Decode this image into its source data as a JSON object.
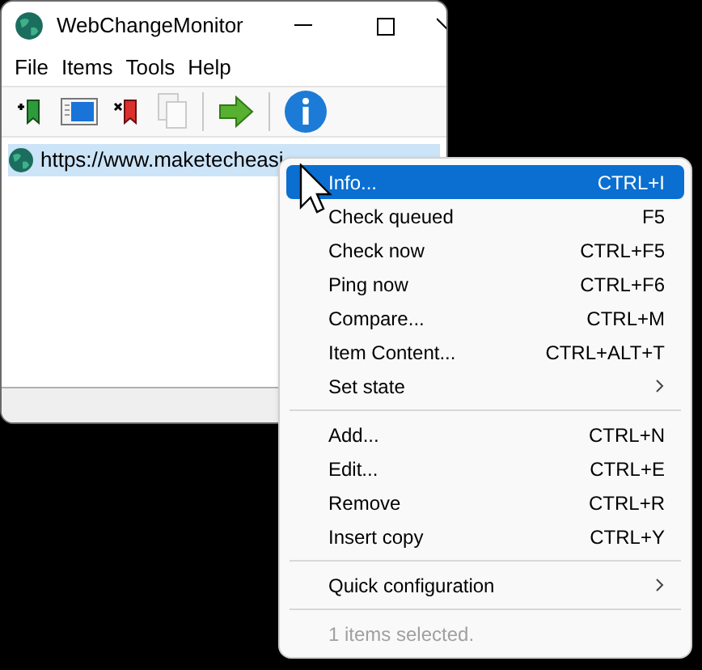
{
  "window": {
    "title": "WebChangeMonitor"
  },
  "menu_bar": [
    "File",
    "Items",
    "Tools",
    "Help"
  ],
  "toolbar": [
    {
      "kind": "add"
    },
    {
      "kind": "view"
    },
    {
      "kind": "remove"
    },
    {
      "kind": "copy",
      "disabled": true
    },
    {
      "kind": "separator"
    },
    {
      "kind": "go"
    },
    {
      "kind": "separator"
    },
    {
      "kind": "info"
    }
  ],
  "list": {
    "items": [
      {
        "text": "https://www.maketecheasi",
        "selected": true
      }
    ]
  },
  "context_menu": {
    "items": [
      {
        "kind": "item",
        "label": "Info...",
        "shortcut": "CTRL+I",
        "selected": true
      },
      {
        "kind": "item",
        "label": "Check queued",
        "shortcut": "F5",
        "selected": false
      },
      {
        "kind": "item",
        "label": "Check now",
        "shortcut": "CTRL+F5",
        "selected": false
      },
      {
        "kind": "item",
        "label": "Ping now",
        "shortcut": "CTRL+F6",
        "selected": false
      },
      {
        "kind": "item",
        "label": "Compare...",
        "shortcut": "CTRL+M",
        "selected": false
      },
      {
        "kind": "item",
        "label": "Item Content...",
        "shortcut": "CTRL+ALT+T",
        "selected": false
      },
      {
        "kind": "submenu",
        "label": "Set state",
        "selected": false
      },
      {
        "kind": "separator"
      },
      {
        "kind": "item",
        "label": "Add...",
        "shortcut": "CTRL+N",
        "selected": false
      },
      {
        "kind": "item",
        "label": "Edit...",
        "shortcut": "CTRL+E",
        "selected": false
      },
      {
        "kind": "item",
        "label": "Remove",
        "shortcut": "CTRL+R",
        "selected": false
      },
      {
        "kind": "item",
        "label": "Insert copy",
        "shortcut": "CTRL+Y",
        "selected": false
      },
      {
        "kind": "separator"
      },
      {
        "kind": "submenu",
        "label": "Quick configuration",
        "selected": false
      },
      {
        "kind": "separator"
      },
      {
        "kind": "note",
        "label": "1 items selected."
      }
    ]
  }
}
